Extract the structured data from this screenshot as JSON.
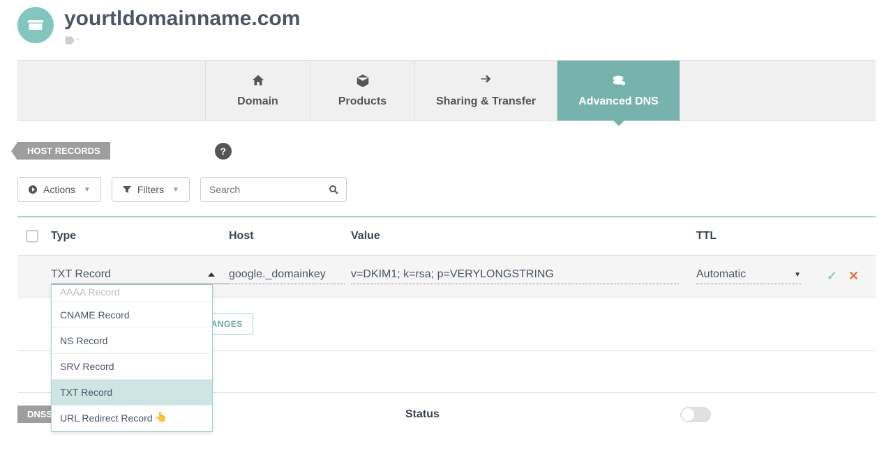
{
  "header": {
    "domain_name": "yourtldomainname.com"
  },
  "tabs": [
    {
      "label": "Domain",
      "active": false
    },
    {
      "label": "Products",
      "active": false
    },
    {
      "label": "Sharing & Transfer",
      "active": false
    },
    {
      "label": "Advanced DNS",
      "active": true
    }
  ],
  "section": {
    "label": "HOST RECORDS"
  },
  "toolbar": {
    "actions_label": "Actions",
    "filters_label": "Filters",
    "search_placeholder": "Search"
  },
  "table": {
    "columns": [
      "Type",
      "Host",
      "Value",
      "TTL"
    ],
    "row": {
      "type": "TXT Record",
      "host": "google._domainkey",
      "value": "v=DKIM1; k=rsa; p=VERYLONGSTRING",
      "ttl": "Automatic"
    }
  },
  "dropdown": {
    "partial_top": "AAAA Record",
    "items": [
      "CNAME Record",
      "NS Record",
      "SRV Record",
      "TXT Record",
      "URL Redirect Record"
    ],
    "highlighted": "TXT Record"
  },
  "save_button": "LL CHANGES",
  "dnssec": {
    "tag": "DNSS",
    "status_label": "Status"
  }
}
